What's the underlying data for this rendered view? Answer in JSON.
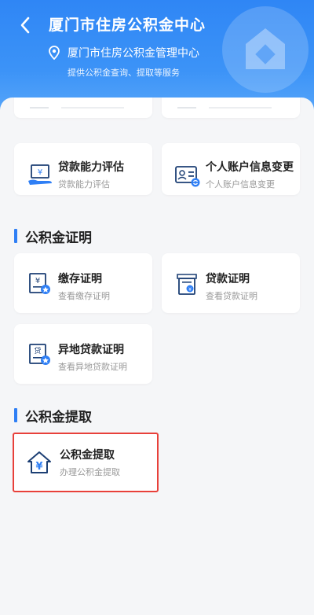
{
  "header": {
    "title": "厦门市住房公积金中心",
    "org_name": "厦门市住房公积金管理中心",
    "subtitle": "提供公积金查询、提取等服务"
  },
  "cards_top": [
    {
      "title": "贷款能力评估",
      "subtitle": "贷款能力评估"
    },
    {
      "title": "个人账户信息变更",
      "subtitle": "个人账户信息变更"
    }
  ],
  "section_certificate": {
    "title": "公积金证明",
    "cards": [
      {
        "title": "缴存证明",
        "subtitle": "查看缴存证明"
      },
      {
        "title": "贷款证明",
        "subtitle": "查看贷款证明"
      },
      {
        "title": "异地贷款证明",
        "subtitle": "查看异地贷款证明"
      }
    ]
  },
  "section_withdraw": {
    "title": "公积金提取",
    "cards": [
      {
        "title": "公积金提取",
        "subtitle": "办理公积金提取"
      }
    ]
  },
  "colors": {
    "accent": "#2f7ff5",
    "header_top": "#2f86f5",
    "highlight_border": "#e8403a"
  },
  "icons": {
    "back": "chevron-left-icon",
    "location": "location-pin-icon",
    "header_deco": "house-icon"
  }
}
